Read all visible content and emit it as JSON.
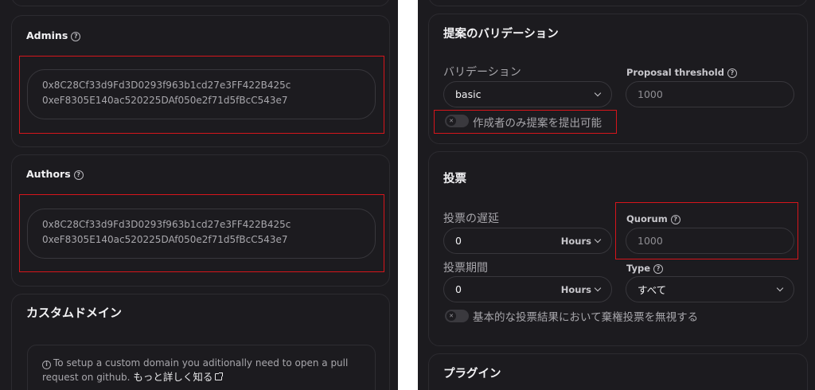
{
  "left": {
    "admins": {
      "title": "Admins",
      "addresses": [
        "0x8C28Cf33d9Fd3D0293f963b1cd27e3FF422B425c",
        "0xeF8305E140ac520225DAf050e2f71d5fBcC543e7"
      ]
    },
    "authors": {
      "title": "Authors",
      "addresses": [
        "0x8C28Cf33d9Fd3D0293f963b1cd27e3FF422B425c",
        "0xeF8305E140ac520225DAf050e2f71d5fBcC543e7"
      ]
    },
    "custom_domain": {
      "title": "カスタムドメイン",
      "info_text": "To setup a custom domain you aditionally need to open a pull request on github.",
      "learn_more": "もっと詳しく知る"
    }
  },
  "right": {
    "validation": {
      "title": "提案のバリデーション",
      "validation_label": "バリデーション",
      "validation_value": "basic",
      "threshold_label": "Proposal threshold",
      "threshold_placeholder": "1000",
      "authors_only_label": "作成者のみ提案を提出可能",
      "authors_only_enabled": false
    },
    "voting": {
      "title": "投票",
      "delay_label": "投票の遅延",
      "delay_value": "0",
      "delay_unit": "Hours",
      "quorum_label": "Quorum",
      "quorum_placeholder": "1000",
      "period_label": "投票期間",
      "period_value": "0",
      "period_unit": "Hours",
      "type_label": "Type",
      "type_value": "すべて",
      "ignore_abstain_label": "基本的な投票結果において棄権投票を無視する",
      "ignore_abstain_enabled": false
    },
    "plugins": {
      "title": "プラグイン"
    }
  },
  "colors": {
    "background": "#1c1b1f",
    "highlight": "#d6151b",
    "border": "#38373c"
  }
}
